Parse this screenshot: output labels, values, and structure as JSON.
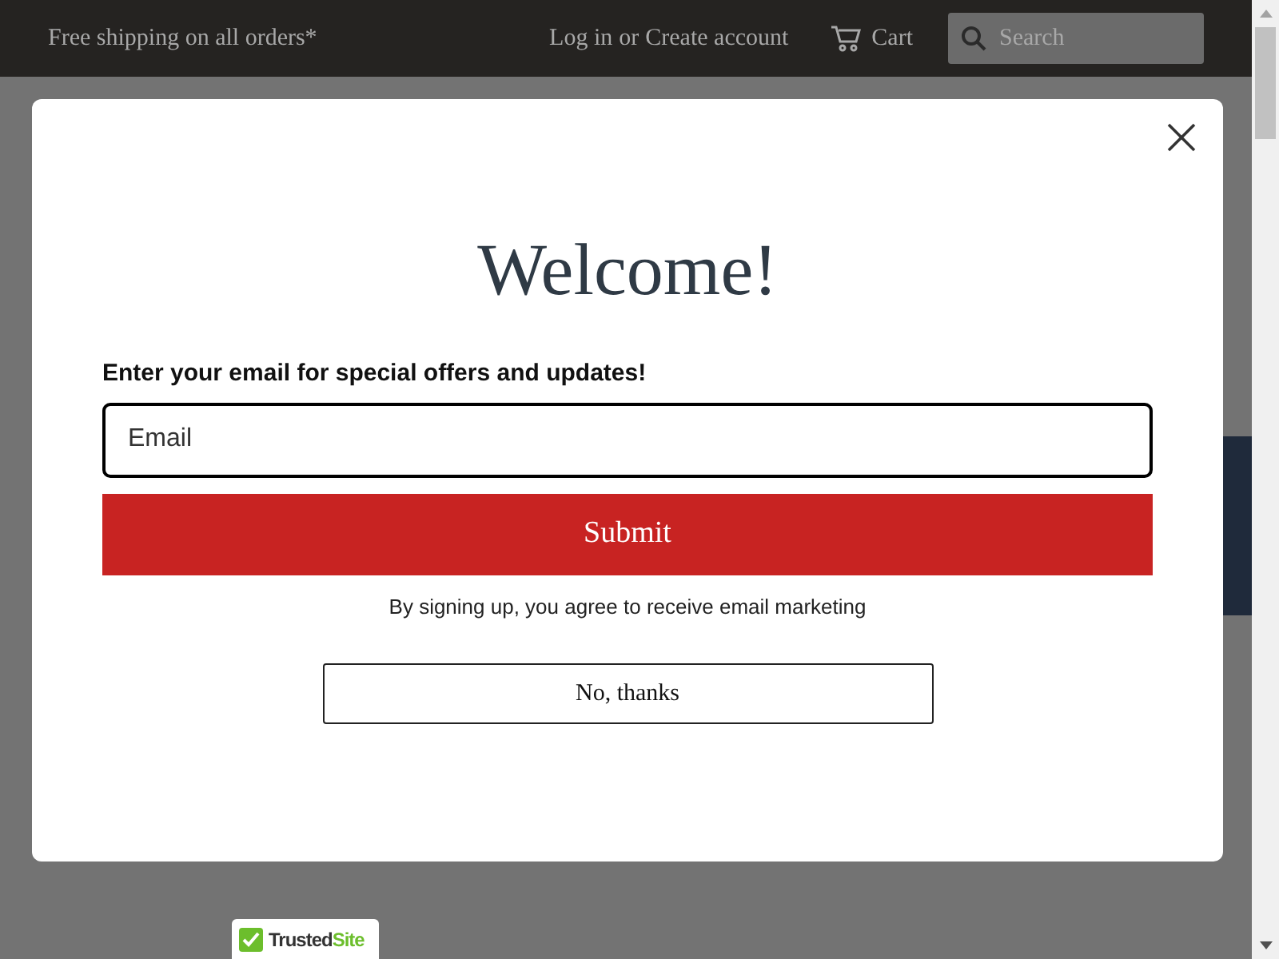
{
  "header": {
    "promo": "Free shipping on all orders*",
    "login": "Log in",
    "or": "or",
    "create_account": "Create account",
    "cart": "Cart",
    "search": {
      "placeholder": "Search"
    }
  },
  "modal": {
    "title": "Welcome!",
    "prompt": "Enter your email for special offers and updates!",
    "email": {
      "placeholder": "Email"
    },
    "submit": "Submit",
    "disclaimer": "By signing up, you agree to receive email marketing",
    "decline": "No, thanks"
  },
  "badge": {
    "brand": "Trusted",
    "suffix": "Site"
  }
}
